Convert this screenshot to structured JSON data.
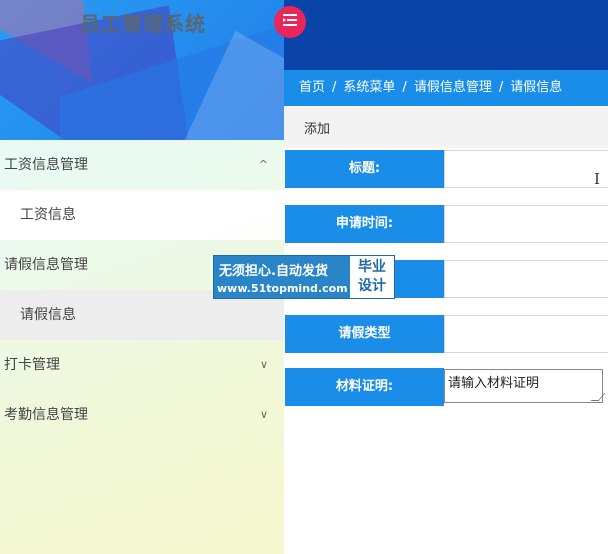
{
  "app": {
    "title": "员工管理系统"
  },
  "sidebar": {
    "toggle_icon": "menu-icon",
    "menu": [
      {
        "label": "工资信息管理",
        "arrow": "^",
        "expanded": true
      },
      {
        "label": "工资信息",
        "sub": true
      },
      {
        "label": "请假信息管理"
      },
      {
        "label": "请假信息",
        "sub": true,
        "active": true
      },
      {
        "label": "打卡管理",
        "arrow": "∨"
      },
      {
        "label": "考勤信息管理",
        "arrow": "∨"
      }
    ]
  },
  "breadcrumb": {
    "items": [
      "首页",
      "系统菜单",
      "请假信息管理",
      "请假信息"
    ],
    "separator": "/"
  },
  "toolbar": {
    "add_label": "添加"
  },
  "form": {
    "fields": [
      {
        "label": "标题:",
        "value": ""
      },
      {
        "label": "申请时间:",
        "value": ""
      },
      {
        "label": "",
        "value": ""
      },
      {
        "label": "请假类型",
        "value": ""
      },
      {
        "label": "材料证明:",
        "placeholder": "请输入材料证明"
      }
    ]
  },
  "watermark": {
    "line1": "无须担心.自动发货",
    "line2": "www.51topmind.com",
    "badge_line1": "毕业",
    "badge_line2": "设计"
  },
  "colors": {
    "topbar": "#0a44a8",
    "accent_blue": "#1a8de8",
    "toggle_pink": "#e8265a"
  }
}
